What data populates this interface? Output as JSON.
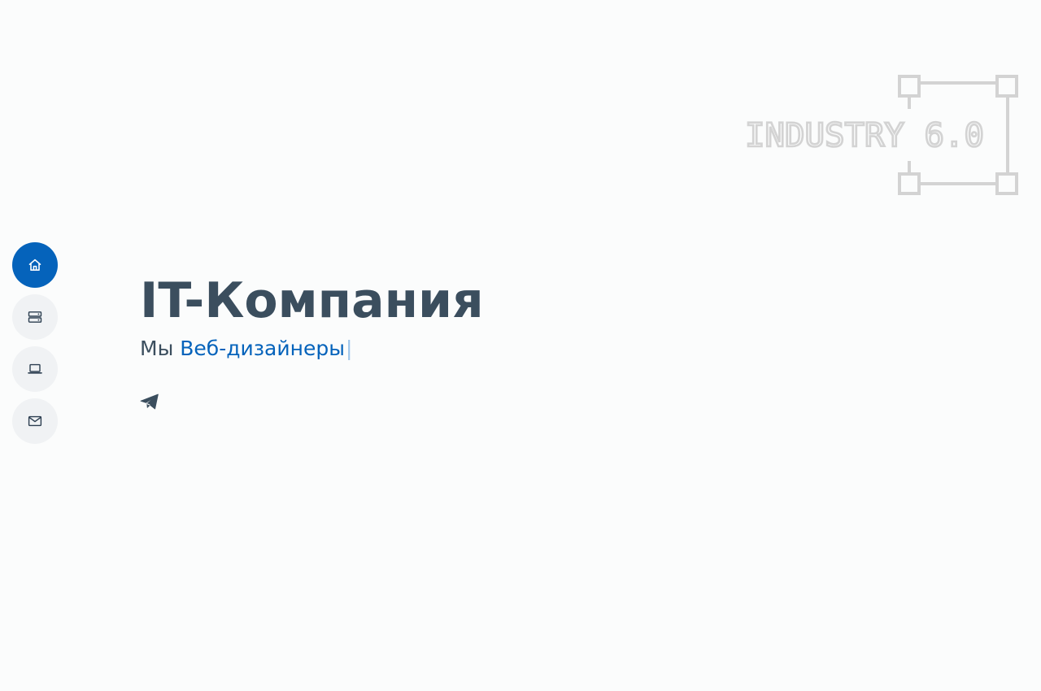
{
  "logo": {
    "text": "INDUSTRY 6.0",
    "color": "#d3d3d3"
  },
  "nav": {
    "items": [
      {
        "name": "home",
        "icon": "home-icon",
        "active": true
      },
      {
        "name": "services",
        "icon": "server-icon",
        "active": false
      },
      {
        "name": "portfolio",
        "icon": "laptop-icon",
        "active": false
      },
      {
        "name": "contact",
        "icon": "envelope-icon",
        "active": false
      }
    ],
    "active_color": "#0563bb",
    "inactive_color": "#f0f2f4"
  },
  "hero": {
    "title": "IT-Компания",
    "subtitle_prefix": "Мы",
    "subtitle_typed": "Веб-дизайнеры",
    "cursor": "|",
    "text_color": "#3b4e5e",
    "accent_color": "#0563bb"
  },
  "social": {
    "icon": "telegram-icon"
  }
}
